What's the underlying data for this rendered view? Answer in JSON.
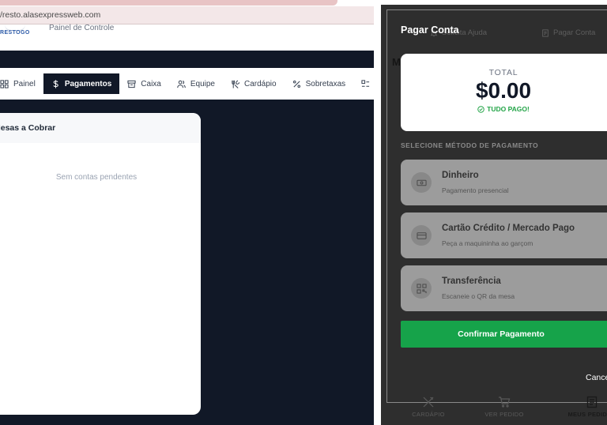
{
  "browser": {
    "url": "/resto.alasexpressweb.com"
  },
  "admin": {
    "logo": "RESTOGO",
    "subtitle": "Painel de Controle",
    "nav": [
      {
        "label": "Painel",
        "icon": "grid-icon"
      },
      {
        "label": "Pagamentos",
        "icon": "dollar-icon",
        "active": true
      },
      {
        "label": "Caixa",
        "icon": "archive-icon"
      },
      {
        "label": "Equipe",
        "icon": "users-icon"
      },
      {
        "label": "Cardápio",
        "icon": "utensils-icon"
      },
      {
        "label": "Sobretaxas",
        "icon": "percent-icon"
      }
    ],
    "card": {
      "title": "Mesas a Cobrar",
      "empty": "Sem contas pendentes"
    }
  },
  "phone": {
    "background": {
      "help": "Solicita Ajuda",
      "pay": "Pagar Conta",
      "section_initial": "M"
    },
    "modal": {
      "title": "Pagar Conta",
      "total_label": "TOTAL",
      "total_value": "$0.00",
      "paid_label": "TUDO PAGO!",
      "methods_title": "SELECIONE MÉTODO DE PAGAMENTO",
      "methods": [
        {
          "name": "Dinheiro",
          "desc": "Pagamento presencial",
          "icon": "cash-icon"
        },
        {
          "name": "Cartão Crédito / Mercado Pago",
          "desc": "Peça a maquininha ao garçom",
          "icon": "card-icon"
        },
        {
          "name": "Transferência",
          "desc": "Escaneie o QR da mesa",
          "icon": "qr-icon"
        }
      ],
      "confirm_label": "Confirmar Pagamento",
      "cancel_label": "Cancel"
    },
    "tabs": [
      {
        "label": "CARDÁPIO",
        "icon": "utensils-icon"
      },
      {
        "label": "VER PEDIDO",
        "icon": "cart-icon"
      },
      {
        "label": "MEUS PEDIDOS",
        "icon": "receipt-icon",
        "active": true
      }
    ]
  },
  "colors": {
    "accent_green": "#16a34a",
    "dark_navy": "#111827",
    "overlay": "#2e2e2e"
  }
}
